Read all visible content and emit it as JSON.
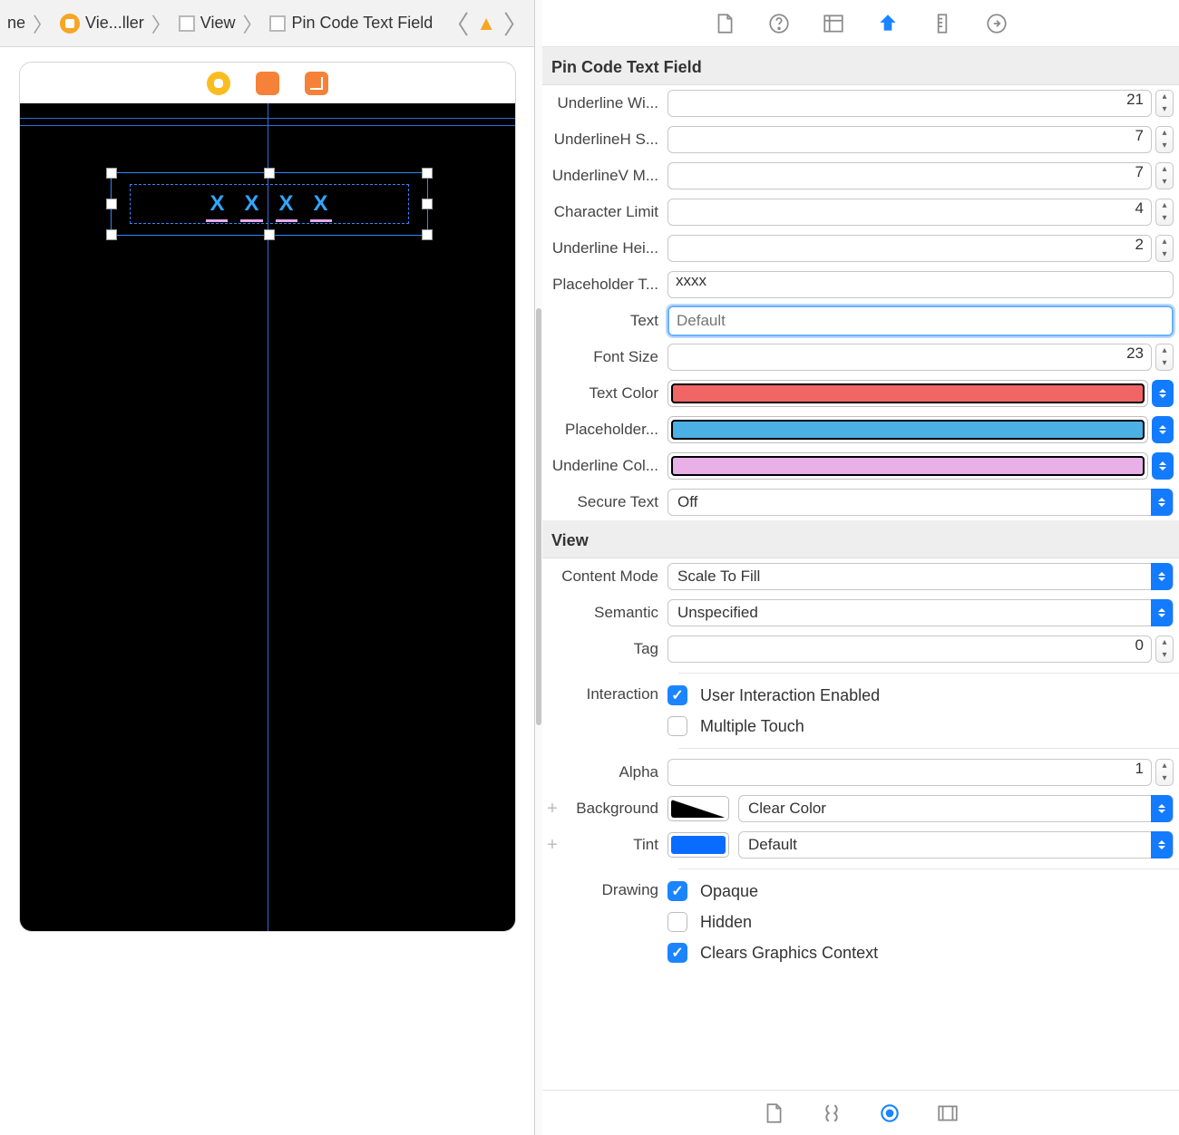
{
  "breadcrumb": {
    "item0": "ne",
    "item1": "Vie...ller",
    "item2": "View",
    "item3": "Pin Code Text Field"
  },
  "canvas": {
    "placeholder_chars": [
      "X",
      "X",
      "X",
      "X"
    ]
  },
  "inspector": {
    "section1_title": "Pin Code Text Field",
    "p1": {
      "label": "Underline Wi...",
      "value": "21"
    },
    "p2": {
      "label": "UnderlineH S...",
      "value": "7"
    },
    "p3": {
      "label": "UnderlineV M...",
      "value": "7"
    },
    "p4": {
      "label": "Character Limit",
      "value": "4"
    },
    "p5": {
      "label": "Underline Hei...",
      "value": "2"
    },
    "p6": {
      "label": "Placeholder T...",
      "value": "xxxx"
    },
    "p7": {
      "label": "Text",
      "placeholder": "Default",
      "value": ""
    },
    "p8": {
      "label": "Font Size",
      "value": "23"
    },
    "c1": {
      "label": "Text Color",
      "color": "#f26565"
    },
    "c2": {
      "label": "Placeholder...",
      "color": "#4bb1e4"
    },
    "c3": {
      "label": "Underline Col...",
      "color": "#e9b0e7"
    },
    "s1": {
      "label": "Secure Text",
      "value": "Off"
    },
    "section2_title": "View",
    "v1": {
      "label": "Content Mode",
      "value": "Scale To Fill"
    },
    "v2": {
      "label": "Semantic",
      "value": "Unspecified"
    },
    "v3": {
      "label": "Tag",
      "value": "0"
    },
    "int": {
      "label": "Interaction",
      "opt1": "User Interaction Enabled",
      "opt2": "Multiple Touch"
    },
    "alpha": {
      "label": "Alpha",
      "value": "1"
    },
    "bg": {
      "label": "Background",
      "value": "Clear Color"
    },
    "tint": {
      "label": "Tint",
      "value": "Default"
    },
    "draw": {
      "label": "Drawing",
      "opt1": "Opaque",
      "opt2": "Hidden",
      "opt3": "Clears Graphics Context"
    }
  }
}
